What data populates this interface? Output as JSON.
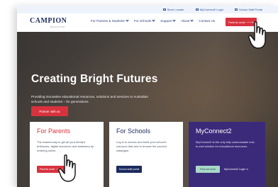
{
  "utility_bar": {
    "links": [
      {
        "label": "Store Locator",
        "icon": "location-icon"
      },
      {
        "label": "MyConnect2 Login",
        "icon": "login-icon"
      },
      {
        "label": "School Staff Portal",
        "icon": "portal-icon"
      }
    ]
  },
  "nav": {
    "logo_text": "CAMPION",
    "logo_subtext": "EDUCATION",
    "menu": [
      {
        "label": "For Parents & Students",
        "has_dropdown": true
      },
      {
        "label": "For Schools",
        "has_dropdown": true
      },
      {
        "label": "Support",
        "has_dropdown": true
      },
      {
        "label": "About",
        "has_dropdown": true
      },
      {
        "label": "Contact Us",
        "has_dropdown": false
      }
    ],
    "cta_label": "Parents order 🡒"
  },
  "hero": {
    "title": "Creating Bright Futures",
    "subtitle": "Providing innovative educational resources, solutions and services to Australian schools and students – for generations.",
    "cta_label": "Partner with us"
  },
  "cards": [
    {
      "title": "For Parents",
      "text": "The easiest way to get all your family's textbooks, digital resources and stationery by ordering online.",
      "button_label": "Parents order 🡒"
    },
    {
      "title": "For Schools",
      "text": "Log in to access and build your school's resource lists and to browse the product catalogue.",
      "button_label": "School staff portal"
    },
    {
      "title": "MyConnect2",
      "text": "MyConnect2 is the only fully customisable end-to-end solution for educational resources.",
      "button_find_label": "Find out more",
      "button_login_label": "MyConnect2 Login ➜"
    }
  ],
  "colors": {
    "brand_red": "#d8323e",
    "brand_navy": "#1a2a5e",
    "brand_purple": "#3b2a7a",
    "mint": "#a8d8c8"
  }
}
